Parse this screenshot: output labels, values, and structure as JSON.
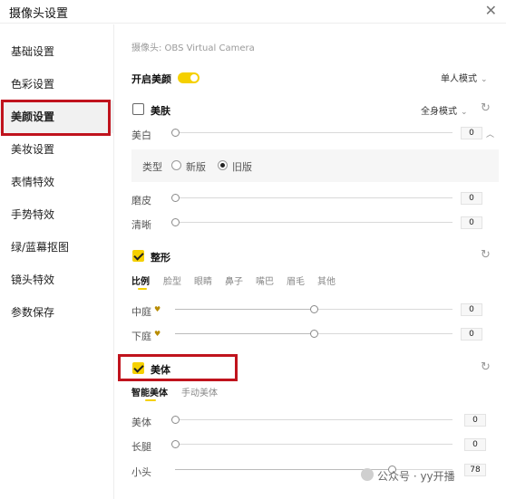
{
  "window": {
    "title": "摄像头设置",
    "close_glyph": "✕"
  },
  "sidebar": {
    "items": [
      {
        "label": "基础设置",
        "active": false
      },
      {
        "label": "色彩设置",
        "active": false
      },
      {
        "label": "美颜设置",
        "active": true
      },
      {
        "label": "美妆设置",
        "active": false
      },
      {
        "label": "表情特效",
        "active": false
      },
      {
        "label": "手势特效",
        "active": false
      },
      {
        "label": "绿/蓝幕抠图",
        "active": false
      },
      {
        "label": "镜头特效",
        "active": false
      },
      {
        "label": "参数保存",
        "active": false
      }
    ]
  },
  "main": {
    "camera_label": "摄像头: OBS Virtual Camera",
    "enable_beauty": {
      "label": "开启美颜",
      "on": true
    },
    "mode_dropdown": {
      "value": "单人模式"
    },
    "skin": {
      "label": "美肤",
      "checked": false,
      "mode_dropdown": "全身模式",
      "whiten": {
        "label": "美白",
        "value": "0"
      },
      "type": {
        "label": "类型",
        "options": [
          {
            "label": "新版",
            "selected": false
          },
          {
            "label": "旧版",
            "selected": true
          }
        ]
      },
      "smooth": {
        "label": "磨皮",
        "value": "0"
      },
      "sharpen": {
        "label": "清晰",
        "value": "0"
      }
    },
    "reshape": {
      "label": "整形",
      "checked": true,
      "tabs": [
        "比例",
        "脸型",
        "眼睛",
        "鼻子",
        "嘴巴",
        "眉毛",
        "其他"
      ],
      "active_tab": "比例",
      "midface": {
        "label": "中庭",
        "value": "0"
      },
      "lowerface": {
        "label": "下庭",
        "value": "0"
      }
    },
    "body": {
      "label": "美体",
      "checked": true,
      "tabs": [
        "智能美体",
        "手动美体"
      ],
      "active_tab": "智能美体",
      "body_slim": {
        "label": "美体",
        "value": "0"
      },
      "long_legs": {
        "label": "长腿",
        "value": "0"
      },
      "small_head": {
        "label": "小头",
        "value": "78"
      }
    }
  },
  "watermark": "公众号 · yy开播",
  "icons": {
    "close": "close-icon",
    "chevron": "chevron-down-icon",
    "collapse": "chevron-up-icon",
    "refresh": "refresh-icon",
    "heart": "heart-icon",
    "wechat": "wechat-icon"
  },
  "colors": {
    "accent": "#f5d000",
    "highlight_box": "#c0131d",
    "sidebar_active_bg": "#f1f1f1"
  }
}
